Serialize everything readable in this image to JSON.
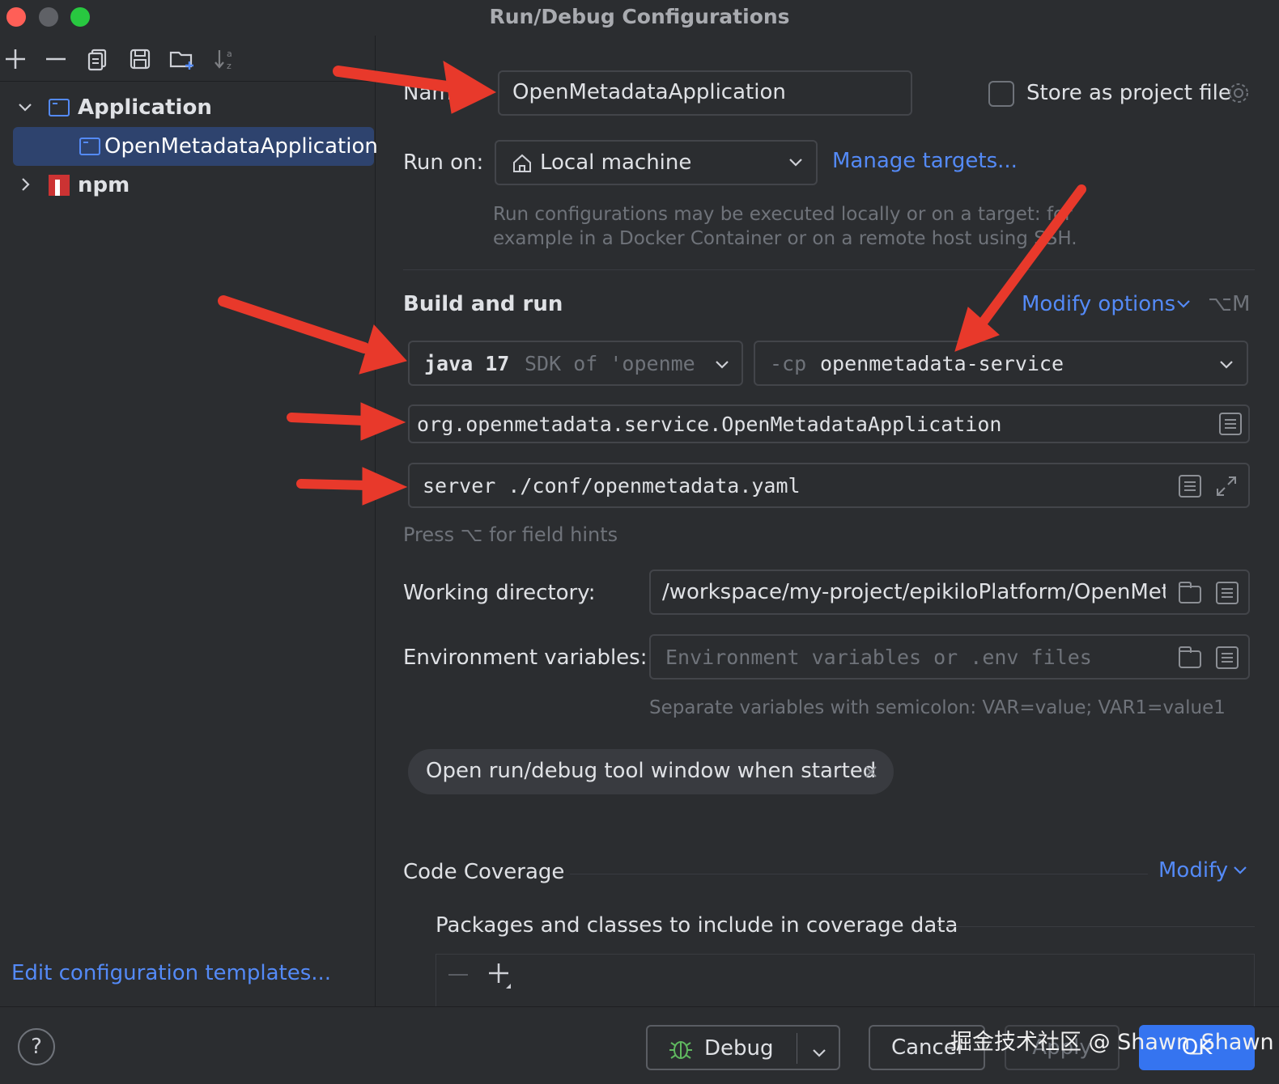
{
  "window": {
    "title": "Run/Debug Configurations"
  },
  "toolbar": {
    "icons": [
      "add-icon",
      "remove-icon",
      "copy-icon",
      "save-icon",
      "new-folder-icon",
      "sort-icon"
    ]
  },
  "tree": {
    "application_label": "Application",
    "selected_item": "OpenMetadataApplication",
    "npm_label": "npm"
  },
  "left_footer": {
    "templates_link": "Edit configuration templates..."
  },
  "form": {
    "name_label": "Name:",
    "name_value": "OpenMetadataApplication",
    "store_label": "Store as project file",
    "run_on_label": "Run on:",
    "run_on_value": "Local machine",
    "manage_targets": "Manage targets...",
    "run_on_hint_1": "Run configurations may be executed locally or on a target: for",
    "run_on_hint_2": "example in a Docker Container or on a remote host using SSH.",
    "build_section": "Build and run",
    "modify_options": "Modify options",
    "modify_shortcut": "⌥M",
    "jdk_bold": "java 17",
    "jdk_dim": "SDK of 'openme",
    "cp_flag": "-cp",
    "cp_value": "openmetadata-service",
    "main_class": "org.openmetadata.service.OpenMetadataApplication",
    "program_args": "server ./conf/openmetadata.yaml",
    "field_hints": "Press ⌥ for field hints",
    "workdir_label": "Working directory:",
    "workdir_value": "/workspace/my-project/epikiloPlatform/OpenMeta",
    "env_label": "Environment variables:",
    "env_placeholder": "Environment variables or .env files",
    "env_hint": "Separate variables with semicolon: VAR=value; VAR1=value1",
    "chip_label": "Open run/debug tool window when started",
    "coverage_section": "Code Coverage",
    "coverage_modify": "Modify",
    "coverage_packages": "Packages and classes to include in coverage data"
  },
  "footer": {
    "help": "?",
    "debug": "Debug",
    "cancel": "Cancel",
    "apply": "Apply",
    "ok": "OK"
  },
  "watermark": "掘金技术社区 @ Shawn_Shawn",
  "colors": {
    "accent": "#548af7",
    "annotation_arrow": "#e8392b",
    "ok_button": "#3574f0"
  }
}
